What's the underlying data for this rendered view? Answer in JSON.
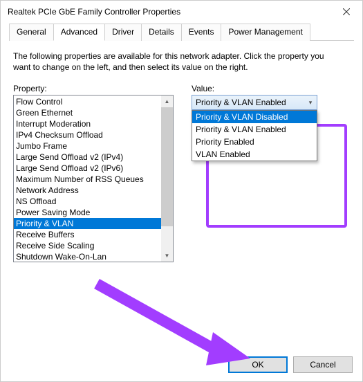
{
  "window": {
    "title": "Realtek PCIe GbE Family Controller Properties"
  },
  "tabs": [
    {
      "label": "General"
    },
    {
      "label": "Advanced"
    },
    {
      "label": "Driver"
    },
    {
      "label": "Details"
    },
    {
      "label": "Events"
    },
    {
      "label": "Power Management"
    }
  ],
  "active_tab_index": 1,
  "description": "The following properties are available for this network adapter. Click the property you want to change on the left, and then select its value on the right.",
  "property_label": "Property:",
  "value_label": "Value:",
  "properties": [
    "Flow Control",
    "Green Ethernet",
    "Interrupt Moderation",
    "IPv4 Checksum Offload",
    "Jumbo Frame",
    "Large Send Offload v2 (IPv4)",
    "Large Send Offload v2 (IPv6)",
    "Maximum Number of RSS Queues",
    "Network Address",
    "NS Offload",
    "Power Saving Mode",
    "Priority & VLAN",
    "Receive Buffers",
    "Receive Side Scaling",
    "Shutdown Wake-On-Lan"
  ],
  "selected_property_index": 11,
  "value": {
    "selected": "Priority & VLAN Enabled",
    "options": [
      "Priority & VLAN Disabled",
      "Priority & VLAN Enabled",
      "Priority Enabled",
      "VLAN Enabled"
    ],
    "highlighted_option_index": 0,
    "dropdown_open": true
  },
  "buttons": {
    "ok": "OK",
    "cancel": "Cancel"
  },
  "annotation": {
    "highlight_color": "#a23dff",
    "arrow_color": "#a23dff"
  }
}
